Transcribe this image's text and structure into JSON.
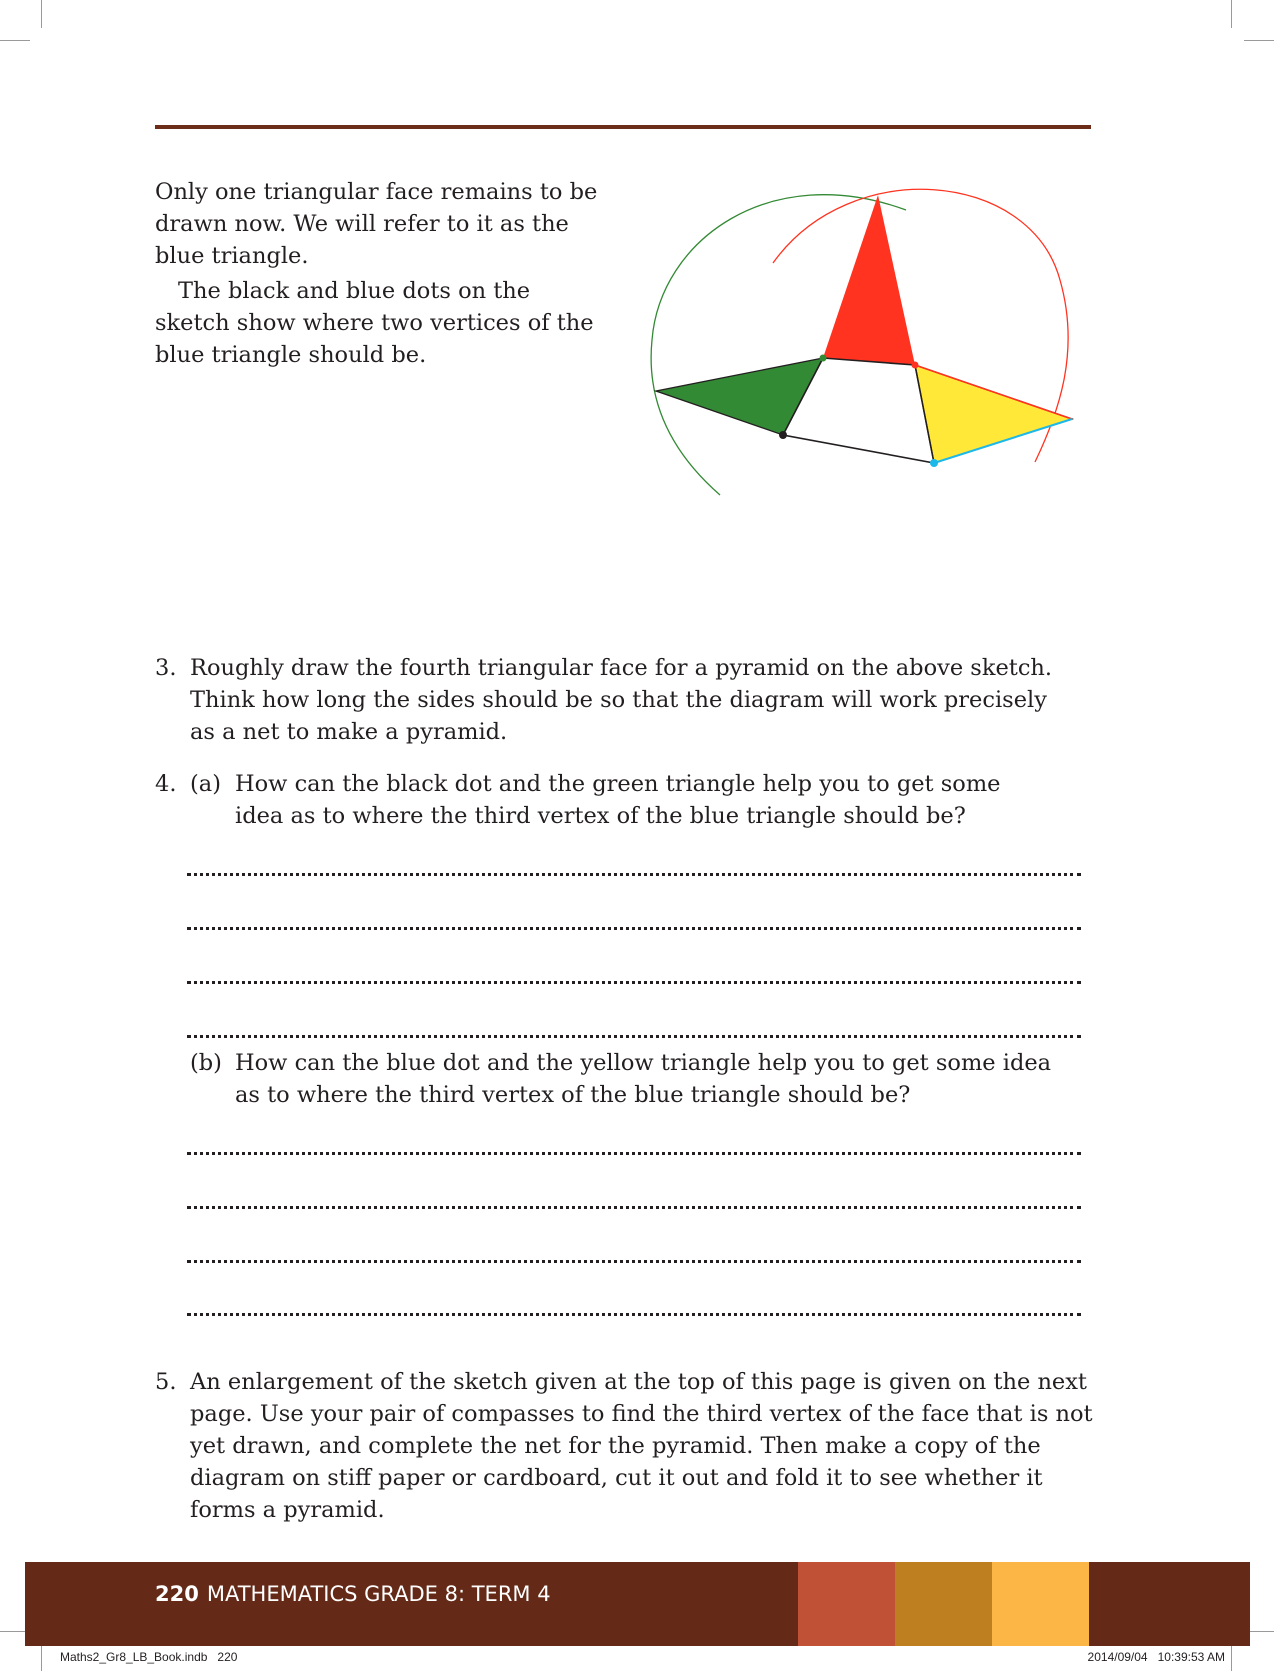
{
  "intro": {
    "paragraph1": "Only one triangular face remains to be drawn now. We will refer to it as the blue triangle.",
    "paragraph2": "The black and blue dots on the sketch show where two vertices of the blue triangle should be."
  },
  "questions": {
    "q3": {
      "number": "3.",
      "text": "Roughly draw the fourth triangular face for a pyramid on the above sketch. Think how long the sides should be so that the diagram will work precisely as a net to make a pyramid."
    },
    "q4": {
      "number": "4.",
      "a": {
        "label": "(a)",
        "text": "How can the black dot and the green triangle help you to get some idea as to where the third vertex of the blue triangle should be?"
      },
      "b": {
        "label": "(b)",
        "text": "How can the blue dot and the yellow triangle help you to get some idea as to where the third vertex of the blue triangle should be?"
      }
    },
    "q5": {
      "number": "5.",
      "text": "An enlargement of the sketch given at the top of this page is given on the next page. Use your pair of compasses to find the third vertex of the face that is not yet drawn, and complete the net for the pyramid. Then make a copy of the diagram on stiff paper or cardboard, cut it out and fold it to see whether it forms a pyramid."
    }
  },
  "footer": {
    "page_number": "220",
    "title": "MATHEMATICS GRADE 8: TERM 4",
    "colors": [
      "#c05136",
      "#bd7f20",
      "#fbb645"
    ]
  },
  "slug": {
    "file": "Maths2_Gr8_LB_Book.indb   220",
    "timestamp": "2014/09/04   10:39:53 AM"
  },
  "sketch": {
    "colors": {
      "red": "#ff3320",
      "green": "#338a34",
      "yellow": "#ffe838",
      "blue": "#1cb8e8",
      "black": "#231f20"
    }
  }
}
